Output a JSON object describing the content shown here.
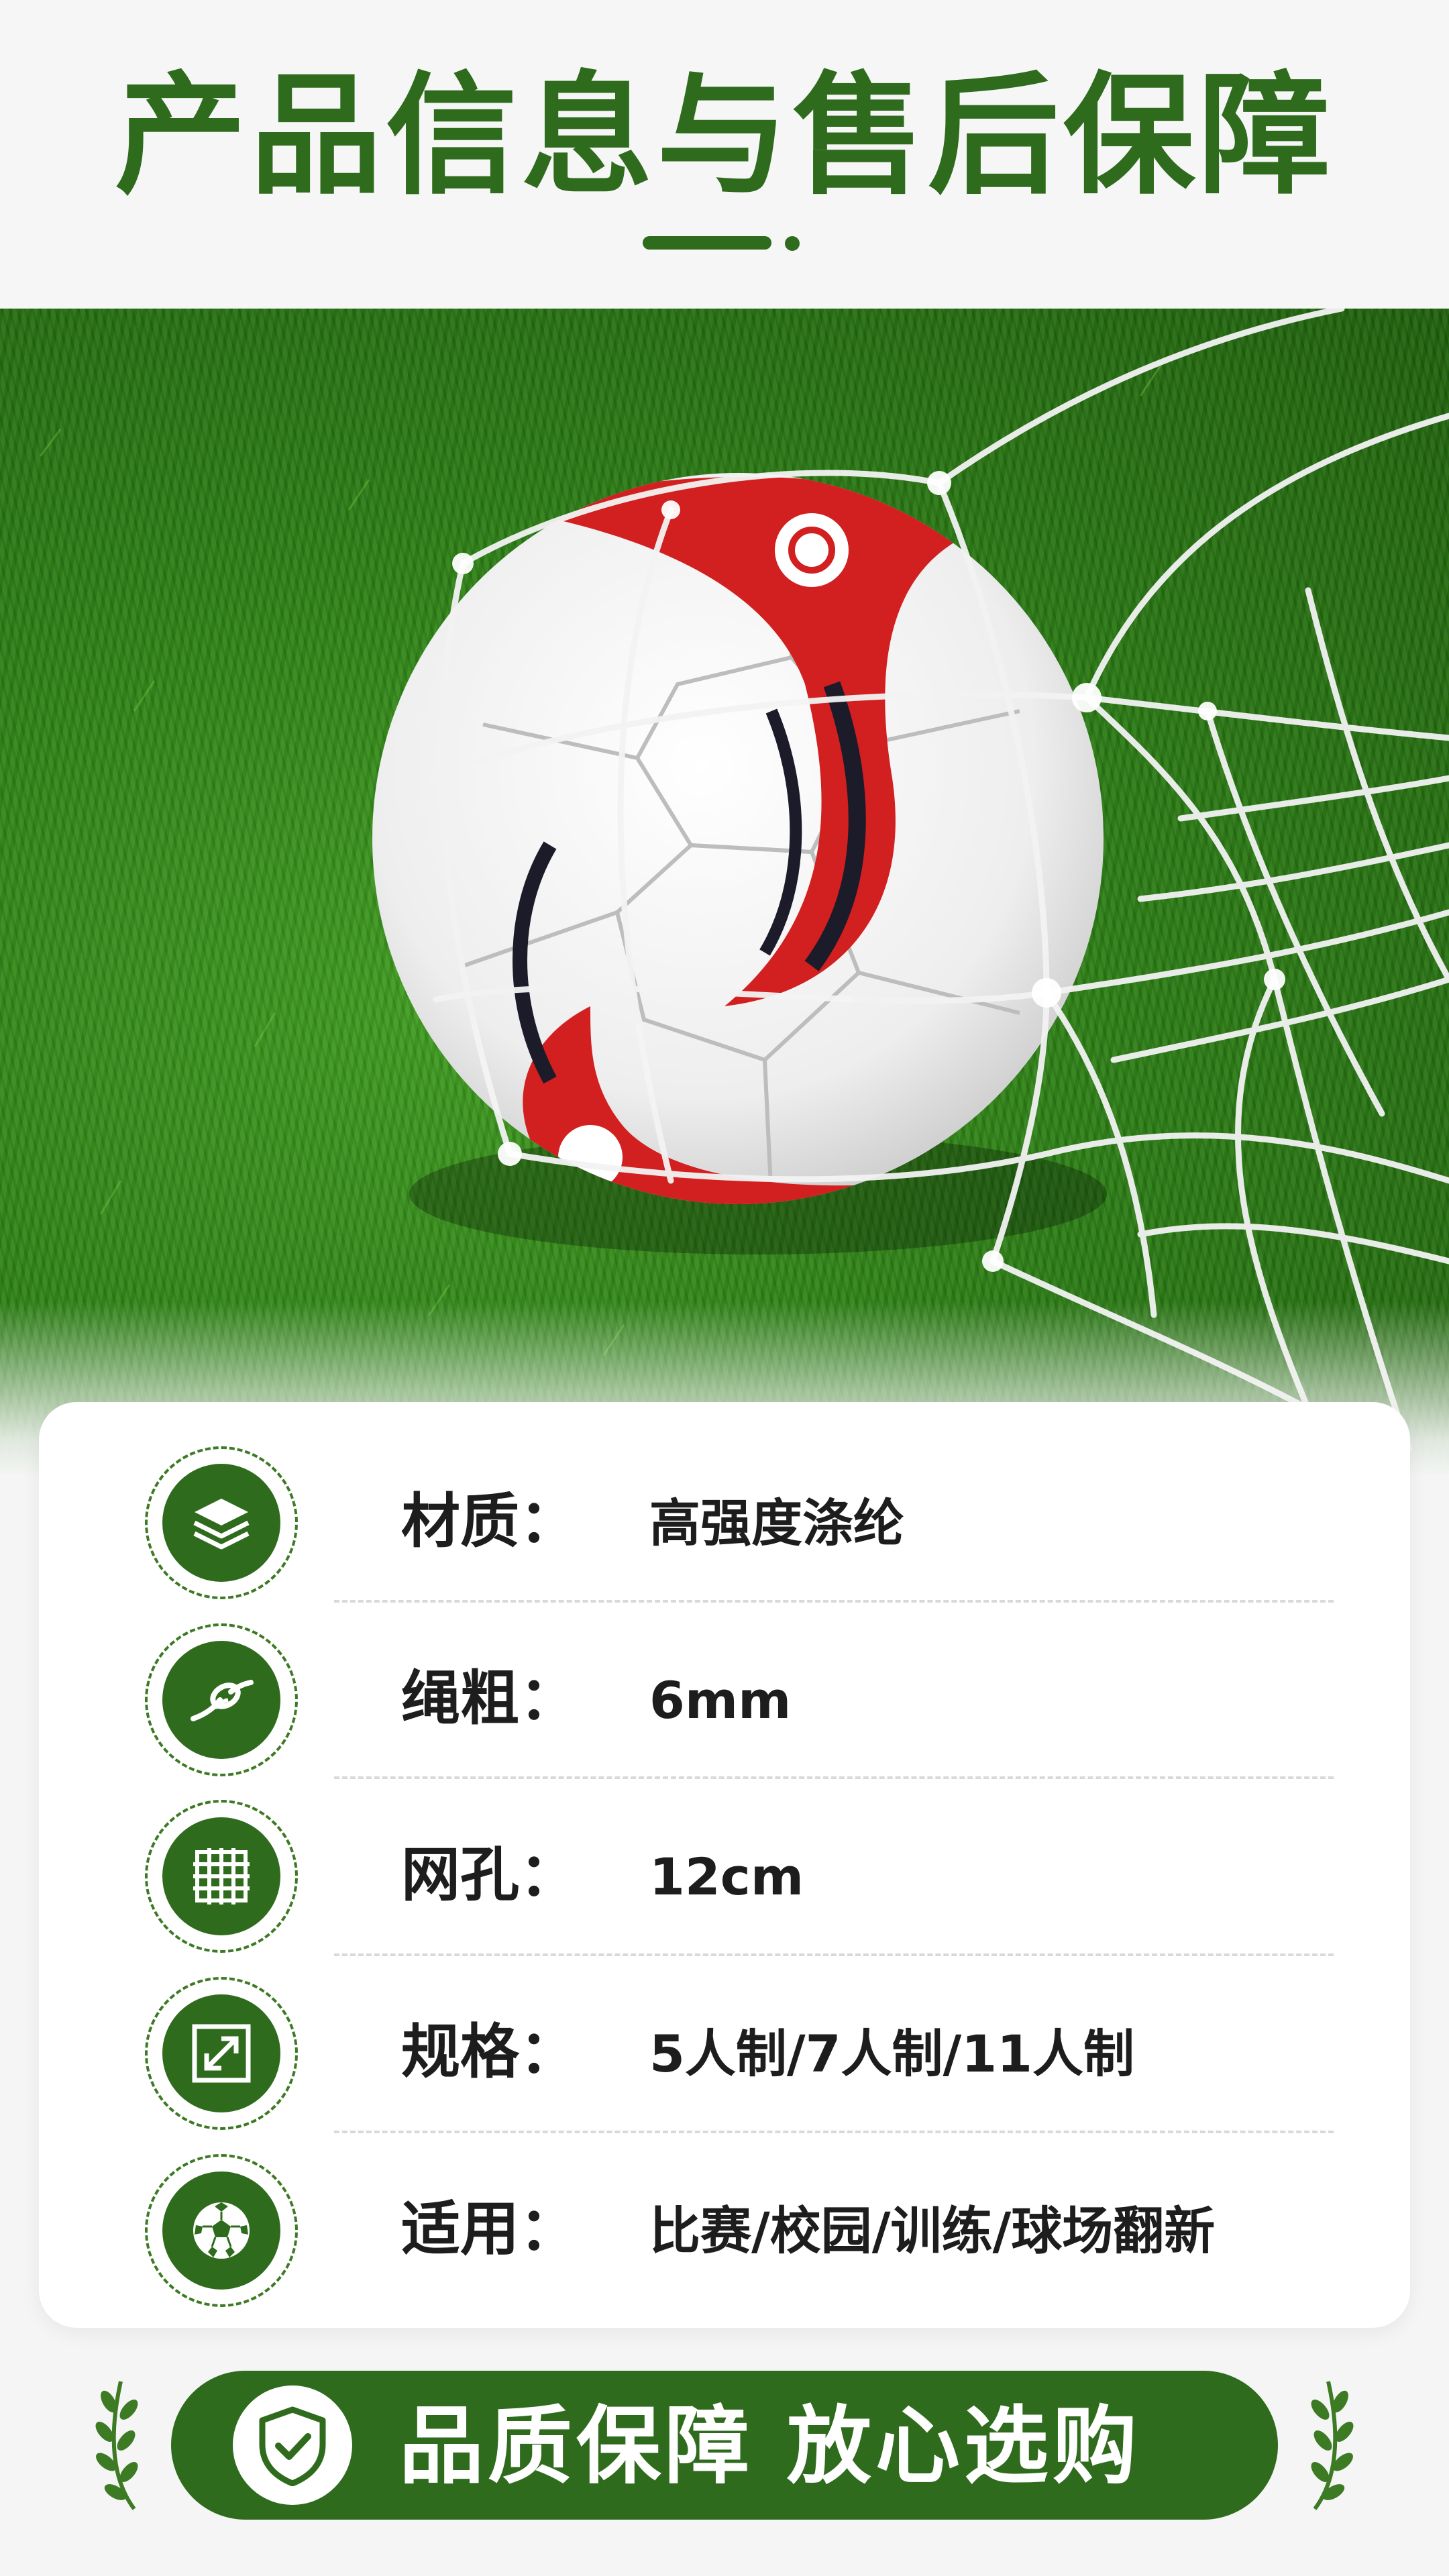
{
  "header": {
    "title": "产品信息与售后保障"
  },
  "photo": {
    "subject": "soccer-ball-in-net-on-turf"
  },
  "specs": [
    {
      "icon": "layers-icon",
      "key": "材质：",
      "value": "高强度涤纶"
    },
    {
      "icon": "rope-knot-icon",
      "key": "绳粗：",
      "value": "6mm"
    },
    {
      "icon": "grid-icon",
      "key": "网孔：",
      "value": "12cm"
    },
    {
      "icon": "expand-icon",
      "key": "规格：",
      "value": "5人制/7人制/11人制"
    },
    {
      "icon": "soccer-ball-icon",
      "key": "适用：",
      "value": "比赛/校园/训练/球场翻新"
    }
  ],
  "banner": {
    "text": "品质保障 放心选购",
    "icon": "shield-check-icon"
  },
  "colors": {
    "brand_green": "#2f6b1d",
    "text_dark": "#1d1d1d",
    "card_bg": "#ffffff",
    "page_bg": "#f4f5f4"
  }
}
